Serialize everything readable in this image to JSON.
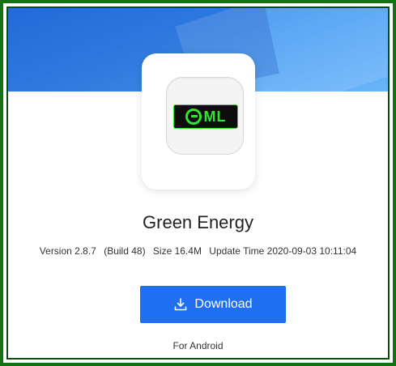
{
  "app": {
    "name": "Green Energy",
    "logo_text": "ML"
  },
  "meta": {
    "version": "Version 2.8.7",
    "build": "(Build 48)",
    "size": "Size 16.4M",
    "update_time": "Update Time 2020-09-03 10:11:04"
  },
  "download": {
    "label": "Download",
    "icon": "download-icon"
  },
  "platform": "For Android",
  "colors": {
    "frame": "#137313",
    "button": "#1f6ff0",
    "logo_green": "#2ee62e",
    "banner": "#3a8cf0"
  }
}
